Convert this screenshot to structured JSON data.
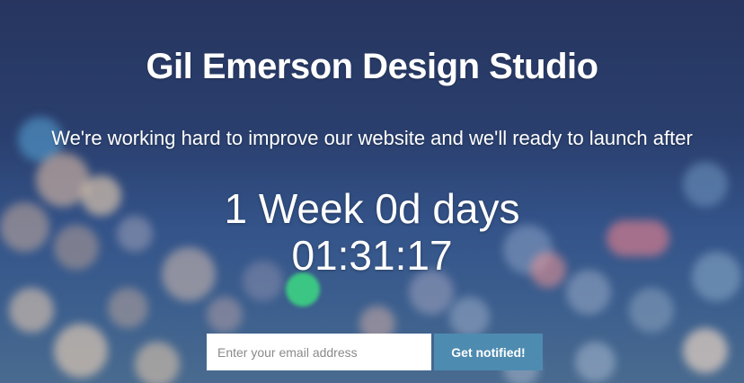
{
  "page": {
    "title": "Gil Emerson Design Studio",
    "subtitle": "We're working hard to improve our website and we'll ready to launch after",
    "countdown_line1": "1 Week 0d days",
    "countdown_line2": "01:31:17"
  },
  "form": {
    "email_placeholder": "Enter your email address",
    "email_value": "",
    "submit_label": "Get notified!"
  },
  "colors": {
    "button": "#4e8bb0",
    "background_top": "#27355f",
    "background_bottom": "#4a6b8f"
  }
}
